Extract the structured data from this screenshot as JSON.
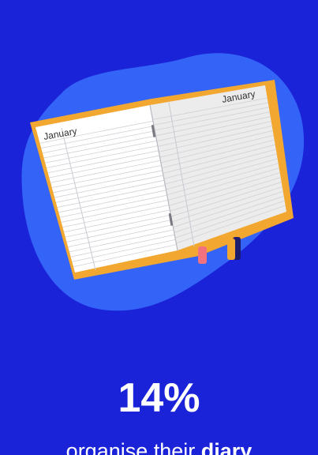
{
  "colors": {
    "background": "#1a23d8",
    "blob": "#3463f7",
    "diary_cover": "#f2a830",
    "page_left": "#ffffff",
    "page_right": "#ececec",
    "page_lines": "#d0d0d6",
    "bookmark_pink": "#f2727f",
    "bookmark_orange": "#f2a830",
    "bookmark_navy": "#1c1c6e",
    "text": "#ffffff"
  },
  "illustration": {
    "icon": "open-diary-icon",
    "left_page_heading": "January",
    "right_page_heading": "January"
  },
  "stat": {
    "value": "14%",
    "caption_prefix": "organise their ",
    "caption_bold": "diary"
  }
}
